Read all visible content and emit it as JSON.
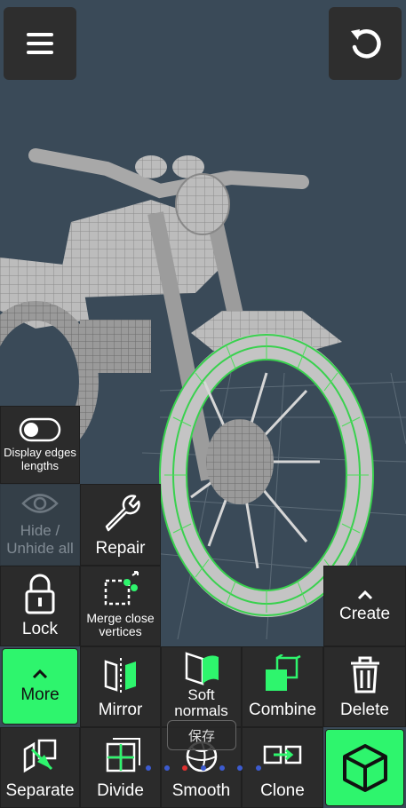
{
  "toolbar": {
    "menu": "menu-icon",
    "undo": "undo-icon"
  },
  "toggle": {
    "label": "Display edges lengths",
    "on": false
  },
  "tiles": {
    "hide": "Hide / Unhide all",
    "repair": "Repair",
    "lock": "Lock",
    "merge": "Merge close vertices",
    "create": "Create",
    "more": "More",
    "mirror": "Mirror",
    "soft": "Soft normals",
    "combine": "Combine",
    "delete": "Delete",
    "separate": "Separate",
    "divide": "Divide",
    "smooth": "Smooth",
    "clone": "Clone"
  },
  "toast": "保存",
  "colors": {
    "accent": "#2ef56d",
    "tile": "#2b2b2b",
    "background": "#3a4a58"
  }
}
